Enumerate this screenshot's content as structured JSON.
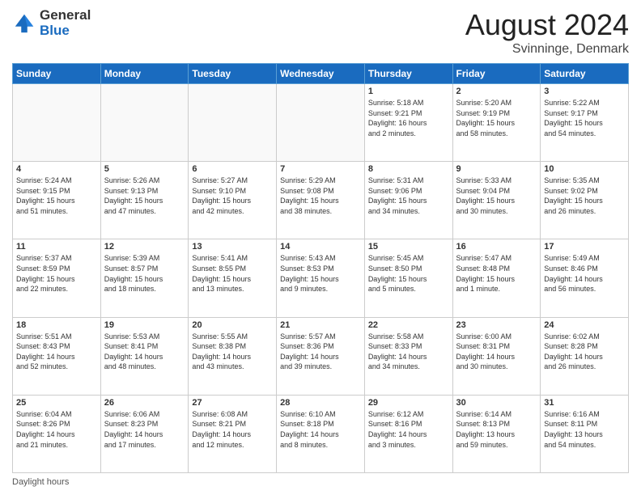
{
  "logo": {
    "general": "General",
    "blue": "Blue"
  },
  "header": {
    "month": "August 2024",
    "location": "Svinninge, Denmark"
  },
  "days_of_week": [
    "Sunday",
    "Monday",
    "Tuesday",
    "Wednesday",
    "Thursday",
    "Friday",
    "Saturday"
  ],
  "footer": {
    "daylight_label": "Daylight hours"
  },
  "weeks": [
    [
      {
        "day": "",
        "info": ""
      },
      {
        "day": "",
        "info": ""
      },
      {
        "day": "",
        "info": ""
      },
      {
        "day": "",
        "info": ""
      },
      {
        "day": "1",
        "info": "Sunrise: 5:18 AM\nSunset: 9:21 PM\nDaylight: 16 hours\nand 2 minutes."
      },
      {
        "day": "2",
        "info": "Sunrise: 5:20 AM\nSunset: 9:19 PM\nDaylight: 15 hours\nand 58 minutes."
      },
      {
        "day": "3",
        "info": "Sunrise: 5:22 AM\nSunset: 9:17 PM\nDaylight: 15 hours\nand 54 minutes."
      }
    ],
    [
      {
        "day": "4",
        "info": "Sunrise: 5:24 AM\nSunset: 9:15 PM\nDaylight: 15 hours\nand 51 minutes."
      },
      {
        "day": "5",
        "info": "Sunrise: 5:26 AM\nSunset: 9:13 PM\nDaylight: 15 hours\nand 47 minutes."
      },
      {
        "day": "6",
        "info": "Sunrise: 5:27 AM\nSunset: 9:10 PM\nDaylight: 15 hours\nand 42 minutes."
      },
      {
        "day": "7",
        "info": "Sunrise: 5:29 AM\nSunset: 9:08 PM\nDaylight: 15 hours\nand 38 minutes."
      },
      {
        "day": "8",
        "info": "Sunrise: 5:31 AM\nSunset: 9:06 PM\nDaylight: 15 hours\nand 34 minutes."
      },
      {
        "day": "9",
        "info": "Sunrise: 5:33 AM\nSunset: 9:04 PM\nDaylight: 15 hours\nand 30 minutes."
      },
      {
        "day": "10",
        "info": "Sunrise: 5:35 AM\nSunset: 9:02 PM\nDaylight: 15 hours\nand 26 minutes."
      }
    ],
    [
      {
        "day": "11",
        "info": "Sunrise: 5:37 AM\nSunset: 8:59 PM\nDaylight: 15 hours\nand 22 minutes."
      },
      {
        "day": "12",
        "info": "Sunrise: 5:39 AM\nSunset: 8:57 PM\nDaylight: 15 hours\nand 18 minutes."
      },
      {
        "day": "13",
        "info": "Sunrise: 5:41 AM\nSunset: 8:55 PM\nDaylight: 15 hours\nand 13 minutes."
      },
      {
        "day": "14",
        "info": "Sunrise: 5:43 AM\nSunset: 8:53 PM\nDaylight: 15 hours\nand 9 minutes."
      },
      {
        "day": "15",
        "info": "Sunrise: 5:45 AM\nSunset: 8:50 PM\nDaylight: 15 hours\nand 5 minutes."
      },
      {
        "day": "16",
        "info": "Sunrise: 5:47 AM\nSunset: 8:48 PM\nDaylight: 15 hours\nand 1 minute."
      },
      {
        "day": "17",
        "info": "Sunrise: 5:49 AM\nSunset: 8:46 PM\nDaylight: 14 hours\nand 56 minutes."
      }
    ],
    [
      {
        "day": "18",
        "info": "Sunrise: 5:51 AM\nSunset: 8:43 PM\nDaylight: 14 hours\nand 52 minutes."
      },
      {
        "day": "19",
        "info": "Sunrise: 5:53 AM\nSunset: 8:41 PM\nDaylight: 14 hours\nand 48 minutes."
      },
      {
        "day": "20",
        "info": "Sunrise: 5:55 AM\nSunset: 8:38 PM\nDaylight: 14 hours\nand 43 minutes."
      },
      {
        "day": "21",
        "info": "Sunrise: 5:57 AM\nSunset: 8:36 PM\nDaylight: 14 hours\nand 39 minutes."
      },
      {
        "day": "22",
        "info": "Sunrise: 5:58 AM\nSunset: 8:33 PM\nDaylight: 14 hours\nand 34 minutes."
      },
      {
        "day": "23",
        "info": "Sunrise: 6:00 AM\nSunset: 8:31 PM\nDaylight: 14 hours\nand 30 minutes."
      },
      {
        "day": "24",
        "info": "Sunrise: 6:02 AM\nSunset: 8:28 PM\nDaylight: 14 hours\nand 26 minutes."
      }
    ],
    [
      {
        "day": "25",
        "info": "Sunrise: 6:04 AM\nSunset: 8:26 PM\nDaylight: 14 hours\nand 21 minutes."
      },
      {
        "day": "26",
        "info": "Sunrise: 6:06 AM\nSunset: 8:23 PM\nDaylight: 14 hours\nand 17 minutes."
      },
      {
        "day": "27",
        "info": "Sunrise: 6:08 AM\nSunset: 8:21 PM\nDaylight: 14 hours\nand 12 minutes."
      },
      {
        "day": "28",
        "info": "Sunrise: 6:10 AM\nSunset: 8:18 PM\nDaylight: 14 hours\nand 8 minutes."
      },
      {
        "day": "29",
        "info": "Sunrise: 6:12 AM\nSunset: 8:16 PM\nDaylight: 14 hours\nand 3 minutes."
      },
      {
        "day": "30",
        "info": "Sunrise: 6:14 AM\nSunset: 8:13 PM\nDaylight: 13 hours\nand 59 minutes."
      },
      {
        "day": "31",
        "info": "Sunrise: 6:16 AM\nSunset: 8:11 PM\nDaylight: 13 hours\nand 54 minutes."
      }
    ]
  ]
}
